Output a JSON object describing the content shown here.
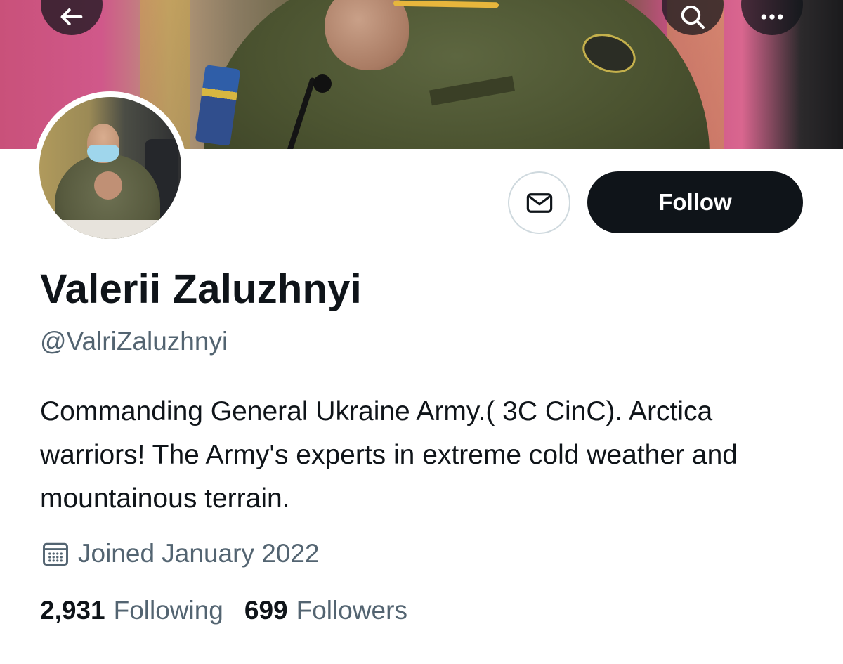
{
  "profile": {
    "display_name": "Valerii Zaluzhnyi",
    "handle": "@ValriZaluzhnyi",
    "bio": "Commanding General Ukraine Army.( 3C CinC). Arctica warriors! The Army's experts in extreme cold weather and mountainous terrain.",
    "joined": "Joined January 2022"
  },
  "actions": {
    "follow_label": "Follow"
  },
  "stats": {
    "following_count": "2,931",
    "following_label": "Following",
    "followers_count": "699",
    "followers_label": "Followers"
  },
  "icons": {
    "back": "arrow-left-icon",
    "search": "search-icon",
    "more": "more-horizontal-icon",
    "message": "envelope-icon",
    "calendar": "calendar-icon"
  },
  "colors": {
    "primary_text": "#0f1419",
    "secondary_text": "#536471",
    "follow_button_bg": "#0f1419",
    "follow_button_text": "#ffffff",
    "border": "#cfd9de"
  }
}
